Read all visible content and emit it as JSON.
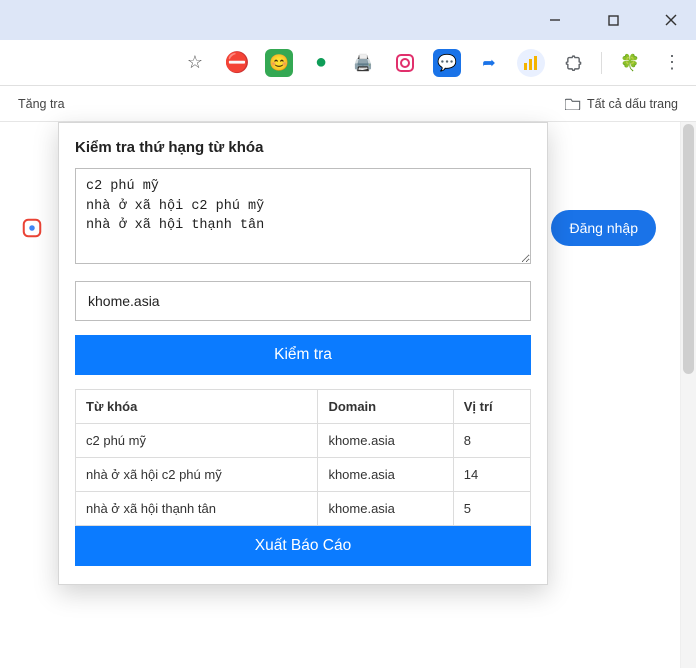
{
  "window_controls": {
    "min": "minimize",
    "max": "maximize",
    "close": "close"
  },
  "toolbar": {
    "star": "☆",
    "icons": [
      {
        "name": "ublock-icon",
        "glyph": "⛔",
        "color": "#d23a2d"
      },
      {
        "name": "emoji-ext-icon",
        "glyph": "😊",
        "bg": "#34a853"
      },
      {
        "name": "hangouts-icon",
        "glyph": "●",
        "color": "#0f9d58"
      },
      {
        "name": "print-ext-icon",
        "glyph": "🖨️",
        "color": "#1a73e8"
      },
      {
        "name": "instagram-ext-icon",
        "glyph": "⬤",
        "color": "#e1306c"
      },
      {
        "name": "messages-ext-icon",
        "glyph": "💬",
        "bg": "#1a73e8"
      },
      {
        "name": "share-ext-icon",
        "glyph": "➦",
        "color": "#1a73e8"
      },
      {
        "name": "rank-checker-ext-icon",
        "glyph": "📊",
        "active": true
      },
      {
        "name": "puzzle-ext-icon",
        "glyph": "🧩",
        "color": "#5f6368"
      },
      {
        "name": "clover-profile-icon",
        "glyph": "🍀"
      },
      {
        "name": "kebab-menu-icon",
        "glyph": "⋮",
        "color": "#5f6368"
      }
    ]
  },
  "bookmarks": {
    "left_label": "Tăng tra",
    "right_label": "Tất cả dấu trang"
  },
  "page": {
    "login_label": "Đăng nhập"
  },
  "popup": {
    "title": "Kiểm tra thứ hạng từ khóa",
    "keywords_text": "c2 phú mỹ\nnhà ở xã hội c2 phú mỹ\nnhà ở xã hội thạnh tân",
    "domain_value": "khome.asia",
    "check_label": "Kiểm tra",
    "export_label": "Xuất Báo Cáo",
    "table": {
      "headers": {
        "kw": "Từ khóa",
        "domain": "Domain",
        "pos": "Vị trí"
      },
      "rows": [
        {
          "kw": "c2 phú mỹ",
          "domain": "khome.asia",
          "pos": "8"
        },
        {
          "kw": "nhà ở xã hội c2 phú mỹ",
          "domain": "khome.asia",
          "pos": "14"
        },
        {
          "kw": "nhà ở xã hội thạnh tân",
          "domain": "khome.asia",
          "pos": "5"
        }
      ]
    }
  }
}
